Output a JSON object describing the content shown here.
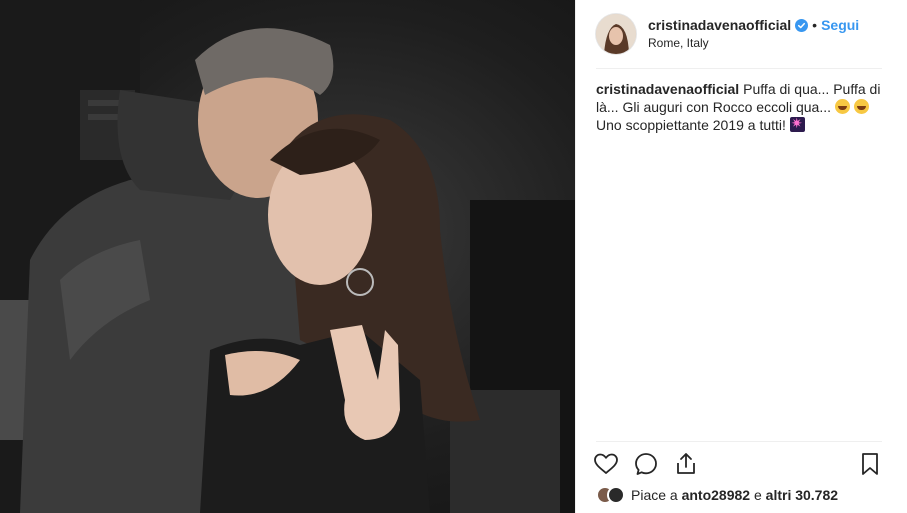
{
  "photo": {
    "alt": ""
  },
  "header": {
    "username": "cristinadavenaofficial",
    "separator": "•",
    "follow_label": "Segui",
    "location": "Rome, Italy"
  },
  "caption": {
    "username": "cristinadavenaofficial",
    "text_part1": "Puffa di qua... Puffa di là... Gli auguri con Rocco eccoli qua...",
    "text_part2": "Uno scoppiettante 2019 a tutti!"
  },
  "likes": {
    "prefix": "Piace a",
    "first_user": "anto28982",
    "middle": "e",
    "others": "altri 30.782"
  },
  "icons": {
    "verified": "verified-badge-icon",
    "like": "heart-icon",
    "comment": "comment-icon",
    "share": "share-icon",
    "save": "bookmark-icon"
  },
  "colors": {
    "link": "#3897f0",
    "text": "#262626",
    "divider": "#efefef"
  }
}
